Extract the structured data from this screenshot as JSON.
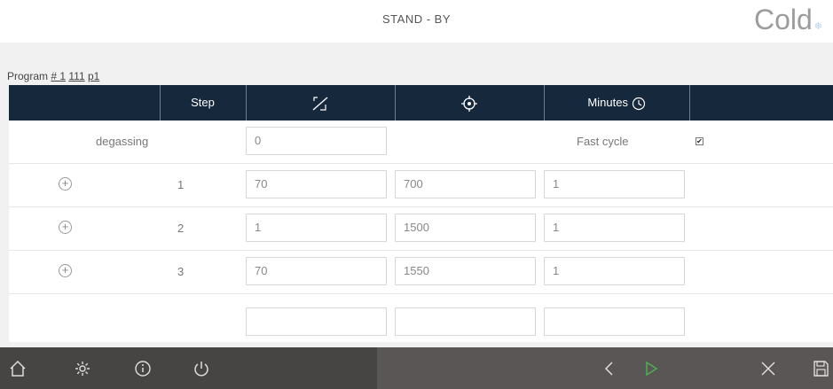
{
  "header": {
    "status": "STAND - BY",
    "mode": "Cold",
    "mode_icon": "snowflake-icon"
  },
  "program": {
    "prefix": "Program ",
    "link1": "# 1",
    "link2": "111",
    "link3": "p1"
  },
  "table": {
    "columns": {
      "step": "Step",
      "slope_icon": "ramp-slope-icon",
      "target_icon": "target-icon",
      "minutes": "Minutes",
      "minutes_icon": "clock-icon"
    },
    "degassing": {
      "label": "degassing",
      "value": "0",
      "fast_cycle_label": "Fast cycle",
      "fast_cycle_checked": true
    },
    "steps": [
      {
        "step": "1",
        "slope": "70",
        "target": "700",
        "minutes": "1"
      },
      {
        "step": "2",
        "slope": "1",
        "target": "1500",
        "minutes": "1"
      },
      {
        "step": "3",
        "slope": "70",
        "target": "1550",
        "minutes": "1"
      }
    ]
  },
  "toolbar": {
    "left_icons": [
      "home-icon",
      "settings-icon",
      "info-icon",
      "power-icon"
    ],
    "right_icons": [
      "back-icon",
      "play-icon",
      "close-icon",
      "save-icon"
    ],
    "colors": {
      "left_bg": "#474444",
      "right_bg": "#5b5656",
      "play": "#4caf50",
      "header_bg": "#16283c"
    }
  }
}
